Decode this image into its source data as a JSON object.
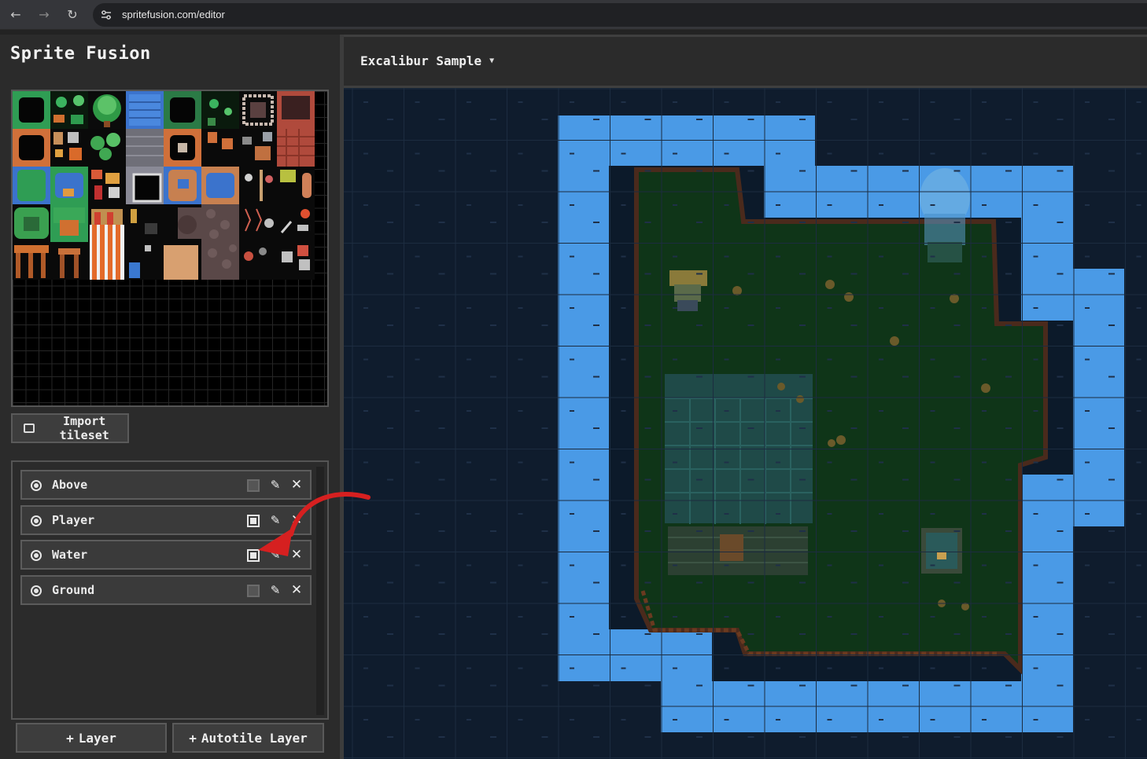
{
  "browser": {
    "url": "spritefusion.com/editor",
    "back_icon": "arrow-left-icon",
    "forward_icon": "arrow-right-icon",
    "reload_icon": "reload-icon"
  },
  "app": {
    "title": "Sprite Fusion",
    "import_label": "Import tileset"
  },
  "map": {
    "name": "Excalibur Sample"
  },
  "layers": [
    {
      "name": "Above",
      "visible": false
    },
    {
      "name": "Player",
      "visible": true
    },
    {
      "name": "Water",
      "visible": true
    },
    {
      "name": "Ground",
      "visible": false
    }
  ],
  "buttons": {
    "add_layer": "Layer",
    "add_autotile_layer": "Autotile Layer",
    "plus_glyph": "+"
  },
  "colors": {
    "water": "#4a9ae6",
    "canvas_bg": "#0f1c2d",
    "grass": "#0f3518",
    "annotation_arrow": "#d62020"
  }
}
